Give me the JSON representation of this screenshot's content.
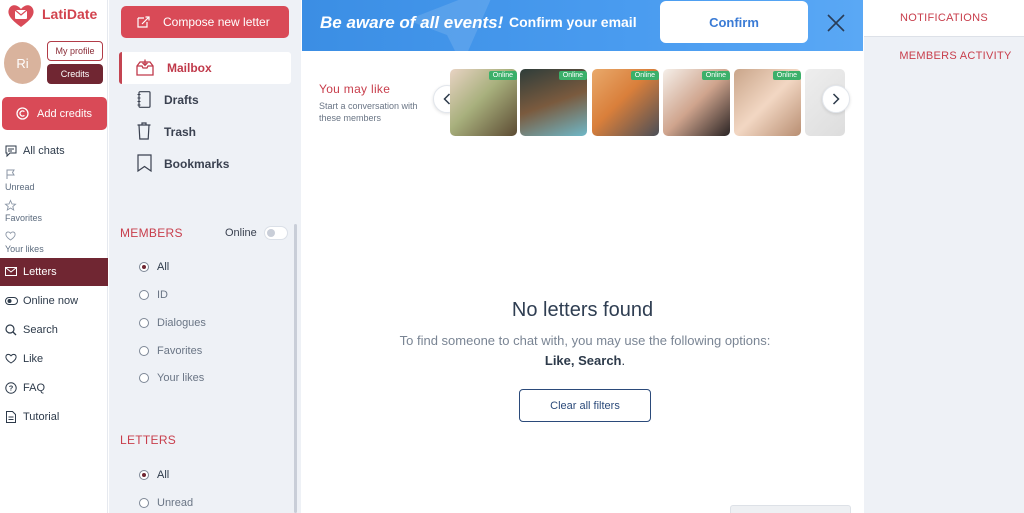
{
  "app": {
    "name": "LatiDate"
  },
  "user": {
    "initials": "Ri",
    "profile_label": "My profile",
    "credits_label": "Credits"
  },
  "add_credits_label": "Add credits",
  "nav": {
    "all_chats": "All chats",
    "filters": [
      "Unread",
      "Favorites",
      "Your likes"
    ],
    "items": [
      "Letters",
      "Online now",
      "Search",
      "Like",
      "FAQ",
      "Tutorial"
    ]
  },
  "compose_label": "Compose new letter",
  "folders": [
    "Mailbox",
    "Drafts",
    "Trash",
    "Bookmarks"
  ],
  "members": {
    "title": "MEMBERS",
    "online_label": "Online",
    "online_toggle": false,
    "options": [
      "All",
      "ID",
      "Dialogues",
      "Favorites",
      "Your likes"
    ],
    "selected": "All"
  },
  "letters_filter": {
    "title": "LETTERS",
    "options": [
      "All",
      "Unread"
    ],
    "selected": "All"
  },
  "banner": {
    "title": "Be aware of all events!",
    "subtitle": "Confirm your email",
    "confirm_label": "Confirm"
  },
  "may_like": {
    "title": "You may like",
    "subtitle": "Start a conversation with these members",
    "badges": [
      "Online",
      "Online",
      "Online",
      "Online",
      "Online"
    ]
  },
  "empty_state": {
    "title": "No letters found",
    "description": "To find someone to chat with, you may use the following options:",
    "link_like": "Like",
    "separator": ", ",
    "link_search": "Search",
    "end": ".",
    "clear_label": "Clear all filters"
  },
  "right_panel": {
    "notifications": "NOTIFICATIONS",
    "activity": "MEMBERS ACTIVITY"
  },
  "colors": {
    "brand_red": "#d94a57",
    "dark_red": "#702632",
    "banner_blue": "#3b8ee4",
    "online_green": "#3bb06a",
    "navy": "#2b4a7a"
  }
}
